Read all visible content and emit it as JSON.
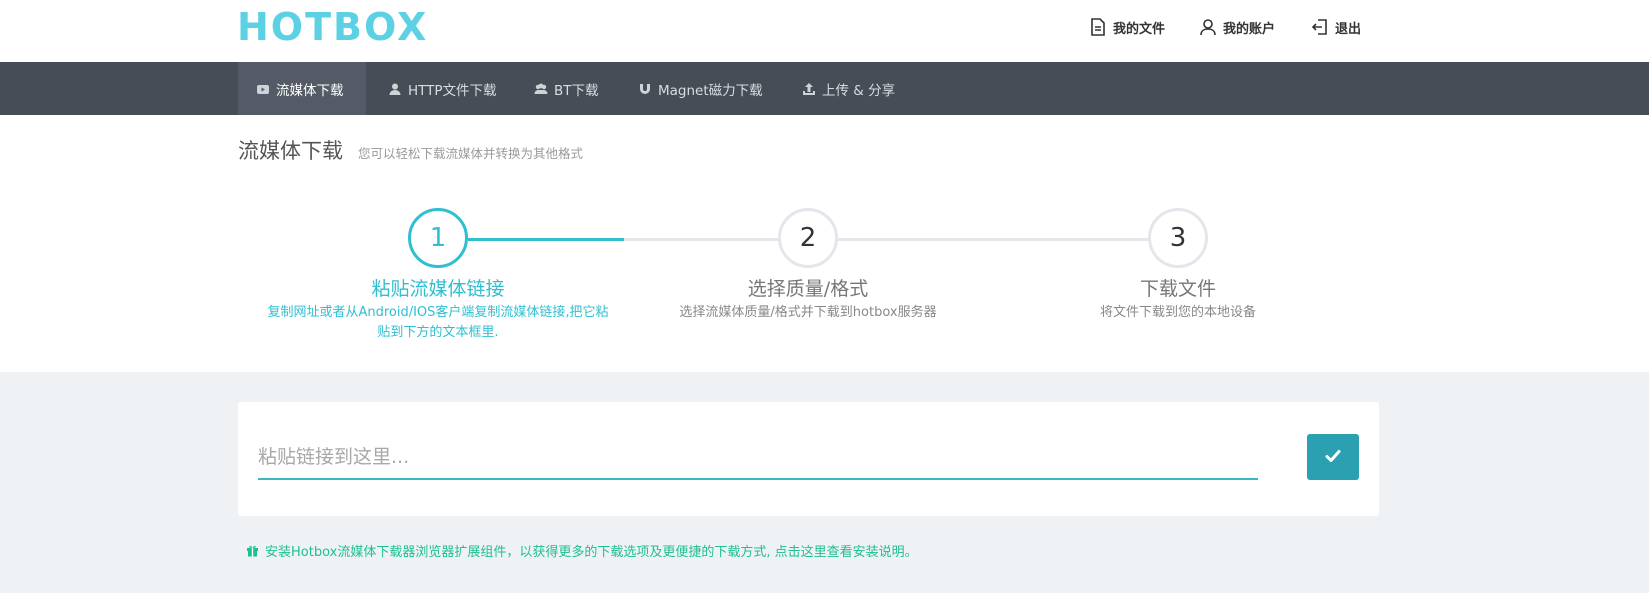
{
  "header": {
    "logo": "HOTBOX",
    "links": [
      {
        "label": "我的文件",
        "icon": "file-icon"
      },
      {
        "label": "我的账户",
        "icon": "user-icon"
      },
      {
        "label": "退出",
        "icon": "sign-out-icon"
      }
    ]
  },
  "nav": {
    "items": [
      {
        "label": "流媒体下载",
        "icon": "youtube-icon",
        "active": true
      },
      {
        "label": "HTTP文件下载",
        "icon": "user-icon",
        "active": false
      },
      {
        "label": "BT下载",
        "icon": "users-icon",
        "active": false
      },
      {
        "label": "Magnet磁力下载",
        "icon": "magnet-icon",
        "active": false
      },
      {
        "label": "上传 & 分享",
        "icon": "upload-icon",
        "active": false
      }
    ]
  },
  "page": {
    "title": "流媒体下载",
    "subtitle": "您可以轻松下载流媒体并转换为其他格式"
  },
  "steps": [
    {
      "number": "1",
      "title": "粘贴流媒体链接",
      "desc_line1": "复制网址或者从Android/IOS客户端复制流媒体链接,把它粘",
      "desc_line2": "贴到下方的文本框里.",
      "active": true
    },
    {
      "number": "2",
      "title": "选择质量/格式",
      "desc_line1": "选择流媒体质量/格式并下载到hotbox服务器",
      "desc_line2": "",
      "active": false
    },
    {
      "number": "3",
      "title": "下载文件",
      "desc_line1": "将文件下载到您的本地设备",
      "desc_line2": "",
      "active": false
    }
  ],
  "form": {
    "placeholder": "粘贴链接到这里...",
    "value": "",
    "submit_icon": "check-icon"
  },
  "notice": {
    "text": "安装Hotbox流媒体下载器浏览器扩展组件，以获得更多的下载选项及更便捷的下载方式, 点击这里查看安装说明。",
    "icon": "gift-icon"
  },
  "colors": {
    "accent": "#2fbfd1",
    "logo": "#5bd1e3",
    "navbar": "#474d57",
    "notice": "#1fbf8f",
    "button": "#2aa0b0"
  }
}
